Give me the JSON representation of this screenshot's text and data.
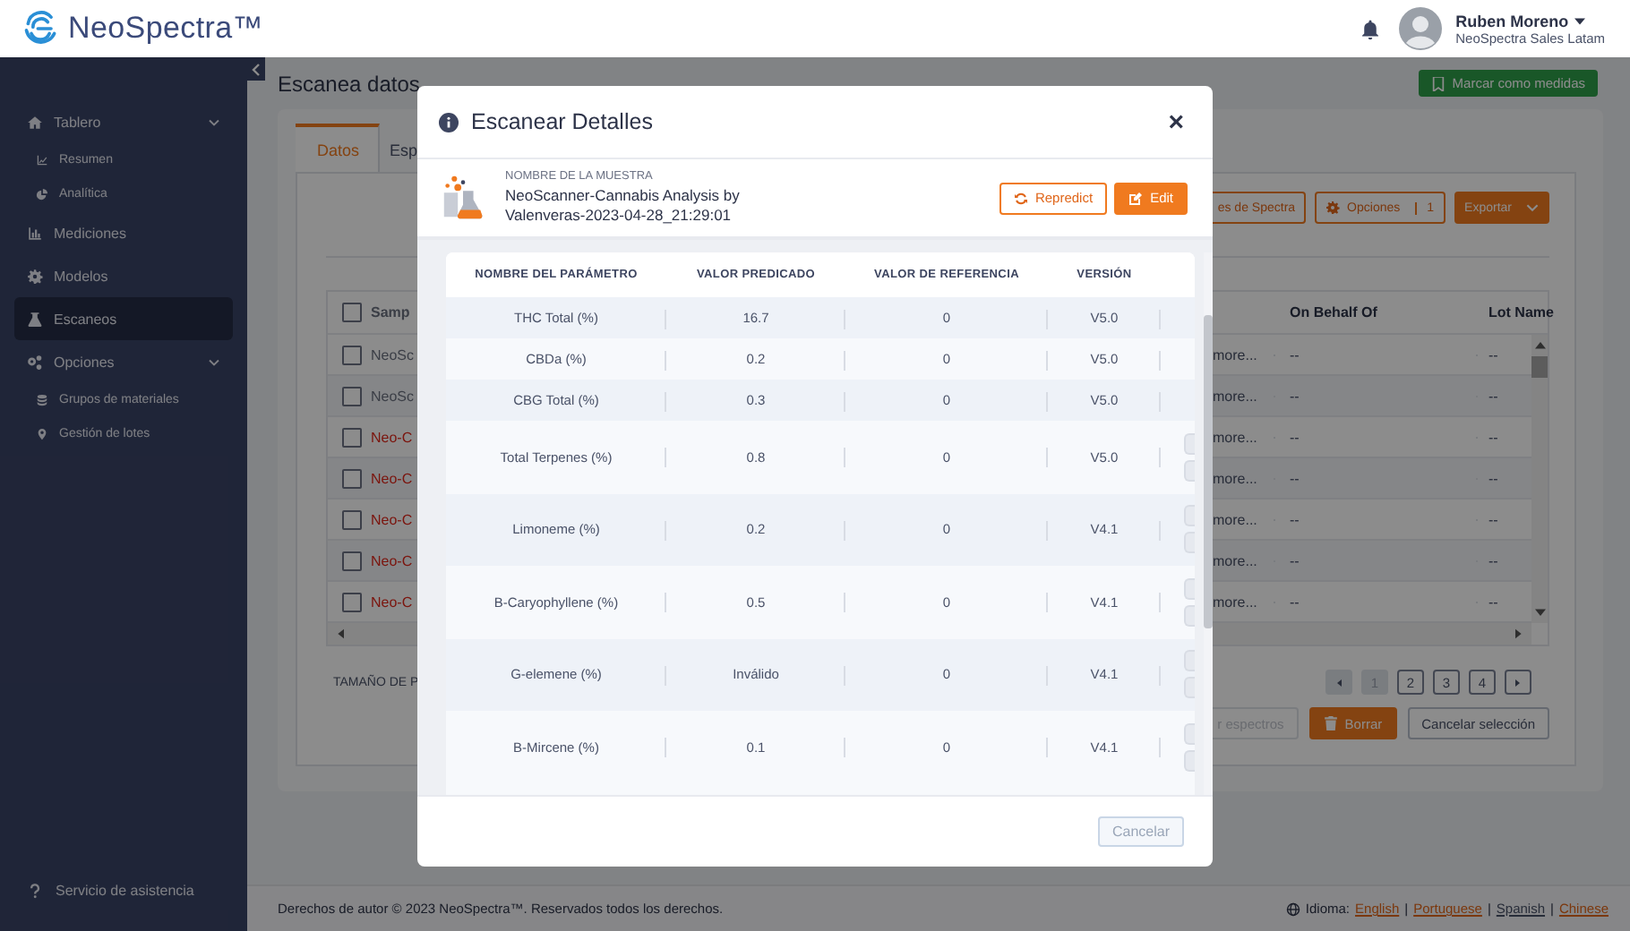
{
  "header": {
    "logo": "NeoSpectra™",
    "user_name": "Ruben Moreno",
    "user_org": "NeoSpectra Sales Latam"
  },
  "sidebar": {
    "items": [
      {
        "label": "Tablero",
        "selected": false,
        "expanded": true,
        "children": [
          {
            "label": "Resumen",
            "selected": false
          },
          {
            "label": "Analítica",
            "selected": false
          }
        ]
      },
      {
        "label": "Mediciones",
        "selected": false
      },
      {
        "label": "Modelos",
        "selected": false
      },
      {
        "label": "Escaneos",
        "selected": true
      },
      {
        "label": "Opciones",
        "selected": false,
        "expanded": true,
        "children": [
          {
            "label": "Grupos de materiales",
            "selected": false
          },
          {
            "label": "Gestión de lotes",
            "selected": false
          }
        ]
      }
    ],
    "help": "Servicio de asistencia"
  },
  "page": {
    "title": "Escanea datos",
    "mark_button": "Marcar como medidas",
    "tabs": [
      {
        "label": "Datos",
        "selected": true
      },
      {
        "label": "Esp",
        "selected": false
      }
    ],
    "toolbar": {
      "spectra_button": "es de Spectra",
      "options_button": "Opciones",
      "options_count": "1",
      "export_button": "Exportar"
    },
    "table": {
      "header_checked": false,
      "columns": [
        "Samp",
        "On Behalf Of",
        "Lot Name"
      ],
      "rows": [
        {
          "checked": false,
          "sample": "NeoSc",
          "error": false,
          "column_3": "more...",
          "on_behalf_of": "--",
          "lot_name": "--"
        },
        {
          "checked": false,
          "sample": "NeoSc",
          "error": false,
          "column_3": "more...",
          "on_behalf_of": "--",
          "lot_name": "--"
        },
        {
          "checked": false,
          "sample": "Neo-C",
          "error": true,
          "column_3": "more...",
          "on_behalf_of": "--",
          "lot_name": "--"
        },
        {
          "checked": false,
          "sample": "Neo-C",
          "error": true,
          "column_3": "more...",
          "on_behalf_of": "--",
          "lot_name": "--"
        },
        {
          "checked": false,
          "sample": "Neo-C",
          "error": true,
          "column_3": "more...",
          "on_behalf_of": "--",
          "lot_name": "--"
        },
        {
          "checked": false,
          "sample": "Neo-C",
          "error": true,
          "column_3": "more...",
          "on_behalf_of": "--",
          "lot_name": "--"
        },
        {
          "checked": false,
          "sample": "Neo-C",
          "error": true,
          "column_3": "more...",
          "on_behalf_of": "--",
          "lot_name": "--"
        }
      ]
    },
    "page_size_label": "TAMAÑO DE P",
    "pages": [
      {
        "label": "1",
        "selected": true
      },
      {
        "label": "2",
        "selected": false
      },
      {
        "label": "3",
        "selected": false
      },
      {
        "label": "4",
        "selected": false
      }
    ],
    "bulk_buttons": {
      "spectra": "r espectros",
      "delete": "Borrar",
      "cancel": "Cancelar selección"
    }
  },
  "modal": {
    "title": "Escanear Detalles",
    "close": "×",
    "sample_label": "NOMBRE DE LA MUESTRA",
    "sample_name": "NeoScanner-Cannabis Analysis by Valenveras-2023-04-28_21:29:01",
    "repredict_button": "Repredict",
    "edit_button": "Edit",
    "columns": [
      "NOMBRE DEL PARÁMETRO",
      "VALOR PREDICADO",
      "VALOR DE REFERENCIA",
      "VERSIÓN"
    ],
    "rows": [
      {
        "parameter": "THC Total (%)",
        "predicted": "16.7",
        "reference": "0",
        "version": "V5.0",
        "has_actions": false
      },
      {
        "parameter": "CBDa (%)",
        "predicted": "0.2",
        "reference": "0",
        "version": "V5.0",
        "has_actions": false
      },
      {
        "parameter": "CBG Total (%)",
        "predicted": "0.3",
        "reference": "0",
        "version": "V5.0",
        "has_actions": false
      },
      {
        "parameter": "Total Terpenes (%)",
        "predicted": "0.8",
        "reference": "0",
        "version": "V5.0",
        "has_actions": true
      },
      {
        "parameter": "Limoneme (%)",
        "predicted": "0.2",
        "reference": "0",
        "version": "V4.1",
        "has_actions": true
      },
      {
        "parameter": "B-Caryophyllene (%)",
        "predicted": "0.5",
        "reference": "0",
        "version": "V4.1",
        "has_actions": true
      },
      {
        "parameter": "G-elemene (%)",
        "predicted": "Inválido",
        "reference": "0",
        "version": "V4.1",
        "has_actions": true
      },
      {
        "parameter": "B-Mircene (%)",
        "predicted": "0.1",
        "reference": "0",
        "version": "V4.1",
        "has_actions": true
      }
    ],
    "cancel_button": "Cancelar"
  },
  "footer": {
    "copyright": "Derechos de autor © 2023 NeoSpectra™. Reservados todos los derechos.",
    "language_label": "Idioma:",
    "separator": "|",
    "languages": [
      {
        "label": "English",
        "selected": false
      },
      {
        "label": "Portuguese",
        "selected": false
      },
      {
        "label": "Spanish",
        "selected": true
      },
      {
        "label": "Chinese",
        "selected": false
      }
    ]
  }
}
